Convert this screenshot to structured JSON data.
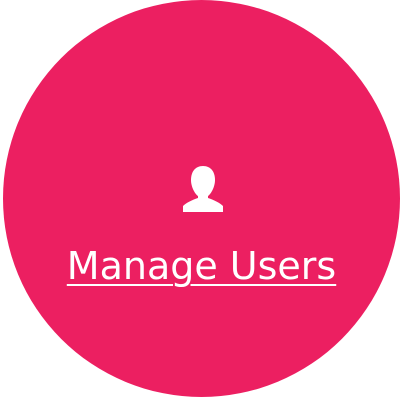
{
  "tile": {
    "label": "Manage Users",
    "icon": "user-icon",
    "background_color": "#ec1f61",
    "text_color": "#ffffff"
  }
}
